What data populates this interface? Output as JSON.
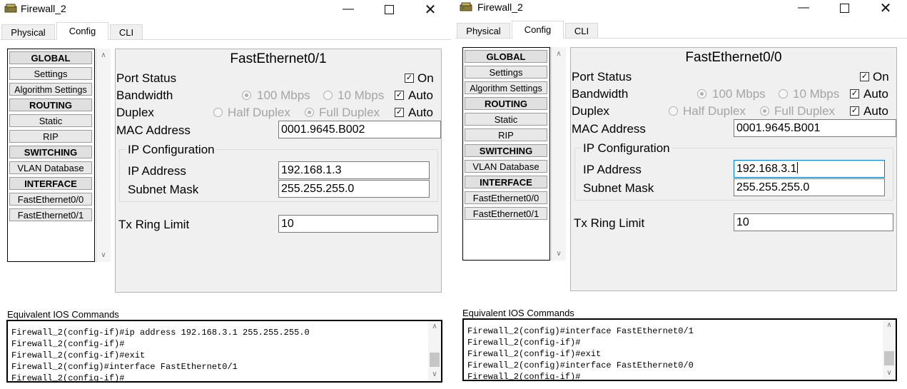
{
  "windows": [
    {
      "title": "Firewall_2",
      "tabs": [
        "Physical",
        "Config",
        "CLI"
      ],
      "active_tab": "Config",
      "sidebar": [
        {
          "label": "GLOBAL",
          "type": "header"
        },
        {
          "label": "Settings",
          "type": "item"
        },
        {
          "label": "Algorithm Settings",
          "type": "item"
        },
        {
          "label": "ROUTING",
          "type": "header"
        },
        {
          "label": "Static",
          "type": "item"
        },
        {
          "label": "RIP",
          "type": "item"
        },
        {
          "label": "SWITCHING",
          "type": "header"
        },
        {
          "label": "VLAN Database",
          "type": "item"
        },
        {
          "label": "INTERFACE",
          "type": "header"
        },
        {
          "label": "FastEthernet0/0",
          "type": "item"
        },
        {
          "label": "FastEthernet0/1",
          "type": "item"
        }
      ],
      "panel": {
        "title": "FastEthernet0/1",
        "port_status_label": "Port Status",
        "port_status_on": "On",
        "bandwidth_label": "Bandwidth",
        "bw_100": "100 Mbps",
        "bw_10": "10 Mbps",
        "bw_auto": "Auto",
        "duplex_label": "Duplex",
        "half_duplex": "Half Duplex",
        "full_duplex": "Full Duplex",
        "duplex_auto": "Auto",
        "mac_label": "MAC Address",
        "mac_value": "0001.9645.B002",
        "ip_config_label": "IP Configuration",
        "ip_label": "IP Address",
        "ip_value": "192.168.1.3",
        "subnet_label": "Subnet Mask",
        "subnet_value": "255.255.255.0",
        "tx_label": "Tx Ring Limit",
        "tx_value": "10"
      },
      "ios_label": "Equivalent IOS Commands",
      "console_lines": [
        "Firewall_2(config-if)#ip address 192.168.3.1 255.255.255.0",
        "Firewall_2(config-if)#",
        "Firewall_2(config-if)#exit",
        "Firewall_2(config)#interface FastEthernet0/1",
        "Firewall_2(config-if)#"
      ]
    },
    {
      "title": "Firewall_2",
      "tabs": [
        "Physical",
        "Config",
        "CLI"
      ],
      "active_tab": "Config",
      "sidebar": [
        {
          "label": "GLOBAL",
          "type": "header"
        },
        {
          "label": "Settings",
          "type": "item"
        },
        {
          "label": "Algorithm Settings",
          "type": "item"
        },
        {
          "label": "ROUTING",
          "type": "header"
        },
        {
          "label": "Static",
          "type": "item"
        },
        {
          "label": "RIP",
          "type": "item"
        },
        {
          "label": "SWITCHING",
          "type": "header"
        },
        {
          "label": "VLAN Database",
          "type": "item"
        },
        {
          "label": "INTERFACE",
          "type": "header"
        },
        {
          "label": "FastEthernet0/0",
          "type": "item"
        },
        {
          "label": "FastEthernet0/1",
          "type": "item"
        }
      ],
      "panel": {
        "title": "FastEthernet0/0",
        "port_status_label": "Port Status",
        "port_status_on": "On",
        "bandwidth_label": "Bandwidth",
        "bw_100": "100 Mbps",
        "bw_10": "10 Mbps",
        "bw_auto": "Auto",
        "duplex_label": "Duplex",
        "half_duplex": "Half Duplex",
        "full_duplex": "Full Duplex",
        "duplex_auto": "Auto",
        "mac_label": "MAC Address",
        "mac_value": "0001.9645.B001",
        "ip_config_label": "IP Configuration",
        "ip_label": "IP Address",
        "ip_value": "192.168.3.1",
        "subnet_label": "Subnet Mask",
        "subnet_value": "255.255.255.0",
        "tx_label": "Tx Ring Limit",
        "tx_value": "10"
      },
      "ios_label": "Equivalent IOS Commands",
      "console_lines": [
        "Firewall_2(config)#interface FastEthernet0/1",
        "Firewall_2(config-if)#",
        "Firewall_2(config-if)#exit",
        "Firewall_2(config)#interface FastEthernet0/0",
        "Firewall_2(config-if)#"
      ]
    }
  ],
  "icons": {
    "app": "router-icon",
    "minimize": "minimize-icon",
    "maximize": "maximize-icon",
    "close": "close-icon",
    "check": "✓"
  },
  "colors": {
    "panel_bg": "#f0f0f0",
    "focus_border": "#0078d7"
  }
}
